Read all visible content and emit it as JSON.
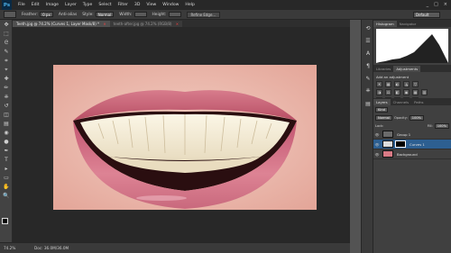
{
  "app": {
    "logo": "Ps"
  },
  "menu": [
    "File",
    "Edit",
    "Image",
    "Layer",
    "Type",
    "Select",
    "Filter",
    "3D",
    "View",
    "Window",
    "Help"
  ],
  "window_controls": [
    "_",
    "□",
    "×"
  ],
  "options_bar": {
    "feather_label": "Feather:",
    "feather_value": "0 px",
    "anti_alias_label": "Anti-alias",
    "style_label": "Style:",
    "style_value": "Normal",
    "width_label": "Width:",
    "height_label": "Height:",
    "refine_edge_label": "Refine Edge...",
    "workspace": "Default"
  },
  "tabs": [
    {
      "label": "Teeth.jpg @ 74.2% (Curves 1, Layer Mask/8) *",
      "active": true,
      "close": "×"
    },
    {
      "label": "teeth-after.jpg @ 74.2% (RGB/8)",
      "active": false,
      "close": "×"
    }
  ],
  "tools": [
    "move-icon",
    "marquee-icon",
    "lasso-icon",
    "quick-select-icon",
    "crop-icon",
    "eyedropper-icon",
    "healing-icon",
    "brush-icon",
    "stamp-icon",
    "history-brush-icon",
    "eraser-icon",
    "gradient-icon",
    "blur-icon",
    "dodge-icon",
    "pen-icon",
    "type-icon",
    "path-select-icon",
    "shape-icon",
    "hand-icon",
    "zoom-icon"
  ],
  "tool_glyphs": [
    "✥",
    "⬚",
    "ᘓ",
    "✎",
    "⌗",
    "⌖",
    "✚",
    "✏",
    "⎈",
    "↺",
    "◫",
    "▤",
    "◉",
    "●",
    "✒",
    "T",
    "▸",
    "▭",
    "✋",
    "🔍"
  ],
  "status": {
    "zoom": "74.2%",
    "doc": "Doc: 36.0M/36.0M"
  },
  "side_icons": [
    "history-icon",
    "properties-icon",
    "character-icon",
    "paragraph-icon",
    "brush-preset-icon",
    "clone-source-icon",
    "tool-preset-icon"
  ],
  "side_glyphs": [
    "⟲",
    "☰",
    "A",
    "¶",
    "✎",
    "⎈",
    "▤"
  ],
  "histogram_panel": {
    "tabs": [
      "Histogram",
      "Navigator"
    ]
  },
  "adjustments_panel": {
    "tabs": [
      "Libraries",
      "Adjustments"
    ],
    "title": "Add an adjustment",
    "row1": [
      "☀",
      "▦",
      "◐",
      "◮",
      "▽"
    ],
    "row2": [
      "◑",
      "⚖",
      "◧",
      "◉",
      "▦",
      "▥"
    ],
    "row3": [
      "◩",
      "◪",
      "◫",
      "◬",
      "◭"
    ]
  },
  "layers_panel": {
    "tabs": [
      "Layers",
      "Channels",
      "Paths"
    ],
    "kind_filter": "Kind",
    "blend_mode": "Normal",
    "opacity_label": "Opacity:",
    "opacity_value": "100%",
    "lock_label": "Lock:",
    "fill_label": "Fill:",
    "fill_value": "100%",
    "layers": [
      {
        "name": "Group 1",
        "selected": false
      },
      {
        "name": "Curves 1",
        "selected": true
      },
      {
        "name": "Background",
        "selected": false
      }
    ]
  },
  "colors": {
    "accent_selection": "#2d5f91",
    "canvas_bg": "#282828",
    "panel_bg": "#404040"
  }
}
